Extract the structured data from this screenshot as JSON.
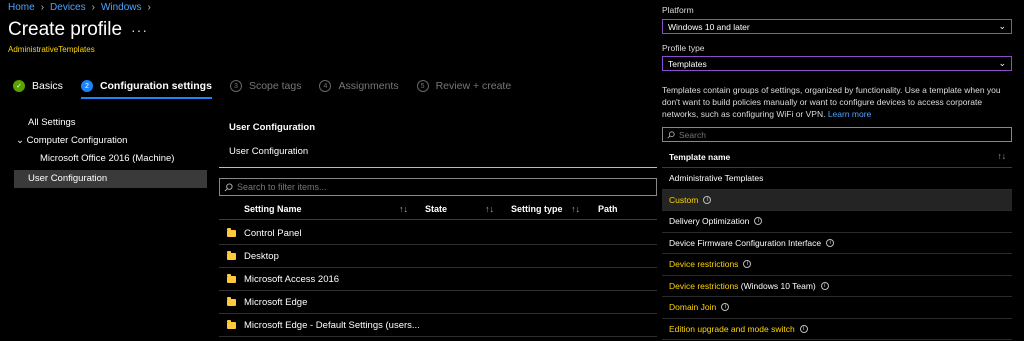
{
  "breadcrumb": [
    "Home",
    "Devices",
    "Windows"
  ],
  "page": {
    "title": "Create profile",
    "more": "···",
    "subtitle": "AdministrativeTemplates"
  },
  "steps": [
    {
      "num": "",
      "label": "Basics",
      "state": "done"
    },
    {
      "num": "2",
      "label": "Configuration settings",
      "state": "active"
    },
    {
      "num": "3",
      "label": "Scope tags",
      "state": "pending"
    },
    {
      "num": "4",
      "label": "Assignments",
      "state": "pending"
    },
    {
      "num": "5",
      "label": "Review + create",
      "state": "pending"
    }
  ],
  "tree": {
    "all_settings": "All Settings",
    "computer_config": "Computer Configuration",
    "office": "Microsoft Office 2016 (Machine)",
    "user_config": "User Configuration"
  },
  "main": {
    "title": "User Configuration",
    "subtitle": "User Configuration",
    "filter_placeholder": "Search to filter items...",
    "columns": [
      "Setting Name",
      "State",
      "Setting type",
      "Path"
    ],
    "rows": [
      "Control Panel",
      "Desktop",
      "Microsoft Access 2016",
      "Microsoft Edge",
      "Microsoft Edge - Default Settings (users..."
    ]
  },
  "right": {
    "platform_label": "Platform",
    "platform_value": "Windows 10 and later",
    "profile_type_label": "Profile type",
    "profile_type_value": "Templates",
    "description": "Templates contain groups of settings, organized by functionality. Use a template when you don't want to build policies manually or want to configure devices to access corporate networks, such as configuring WiFi or VPN.",
    "learn_more": "Learn more",
    "search_placeholder": "Search",
    "column": "Template name",
    "templates": [
      {
        "name": "Administrative Templates",
        "suffix": "",
        "yellow": false,
        "info": false,
        "highlight": false
      },
      {
        "name": "Custom",
        "suffix": "",
        "yellow": true,
        "info": true,
        "highlight": true
      },
      {
        "name": "Delivery Optimization",
        "suffix": "",
        "yellow": false,
        "info": true,
        "highlight": false
      },
      {
        "name": "Device Firmware Configuration Interface",
        "suffix": "",
        "yellow": false,
        "info": true,
        "highlight": false
      },
      {
        "name": "Device restrictions",
        "suffix": "",
        "yellow": true,
        "info": true,
        "highlight": false
      },
      {
        "name": "Device restrictions",
        "suffix": " (Windows 10 Team)",
        "yellow": true,
        "info": true,
        "highlight": false
      },
      {
        "name": "Domain Join",
        "suffix": "",
        "yellow": true,
        "info": true,
        "highlight": false
      },
      {
        "name": "Edition upgrade and mode switch",
        "suffix": "",
        "yellow": true,
        "info": true,
        "highlight": false
      }
    ]
  },
  "colors": {
    "accent": "#1a84ff",
    "highlight_text": "#ffd600",
    "success": "#57a300",
    "select_border": "#8a4fc8",
    "folder": "#ffc83d"
  }
}
